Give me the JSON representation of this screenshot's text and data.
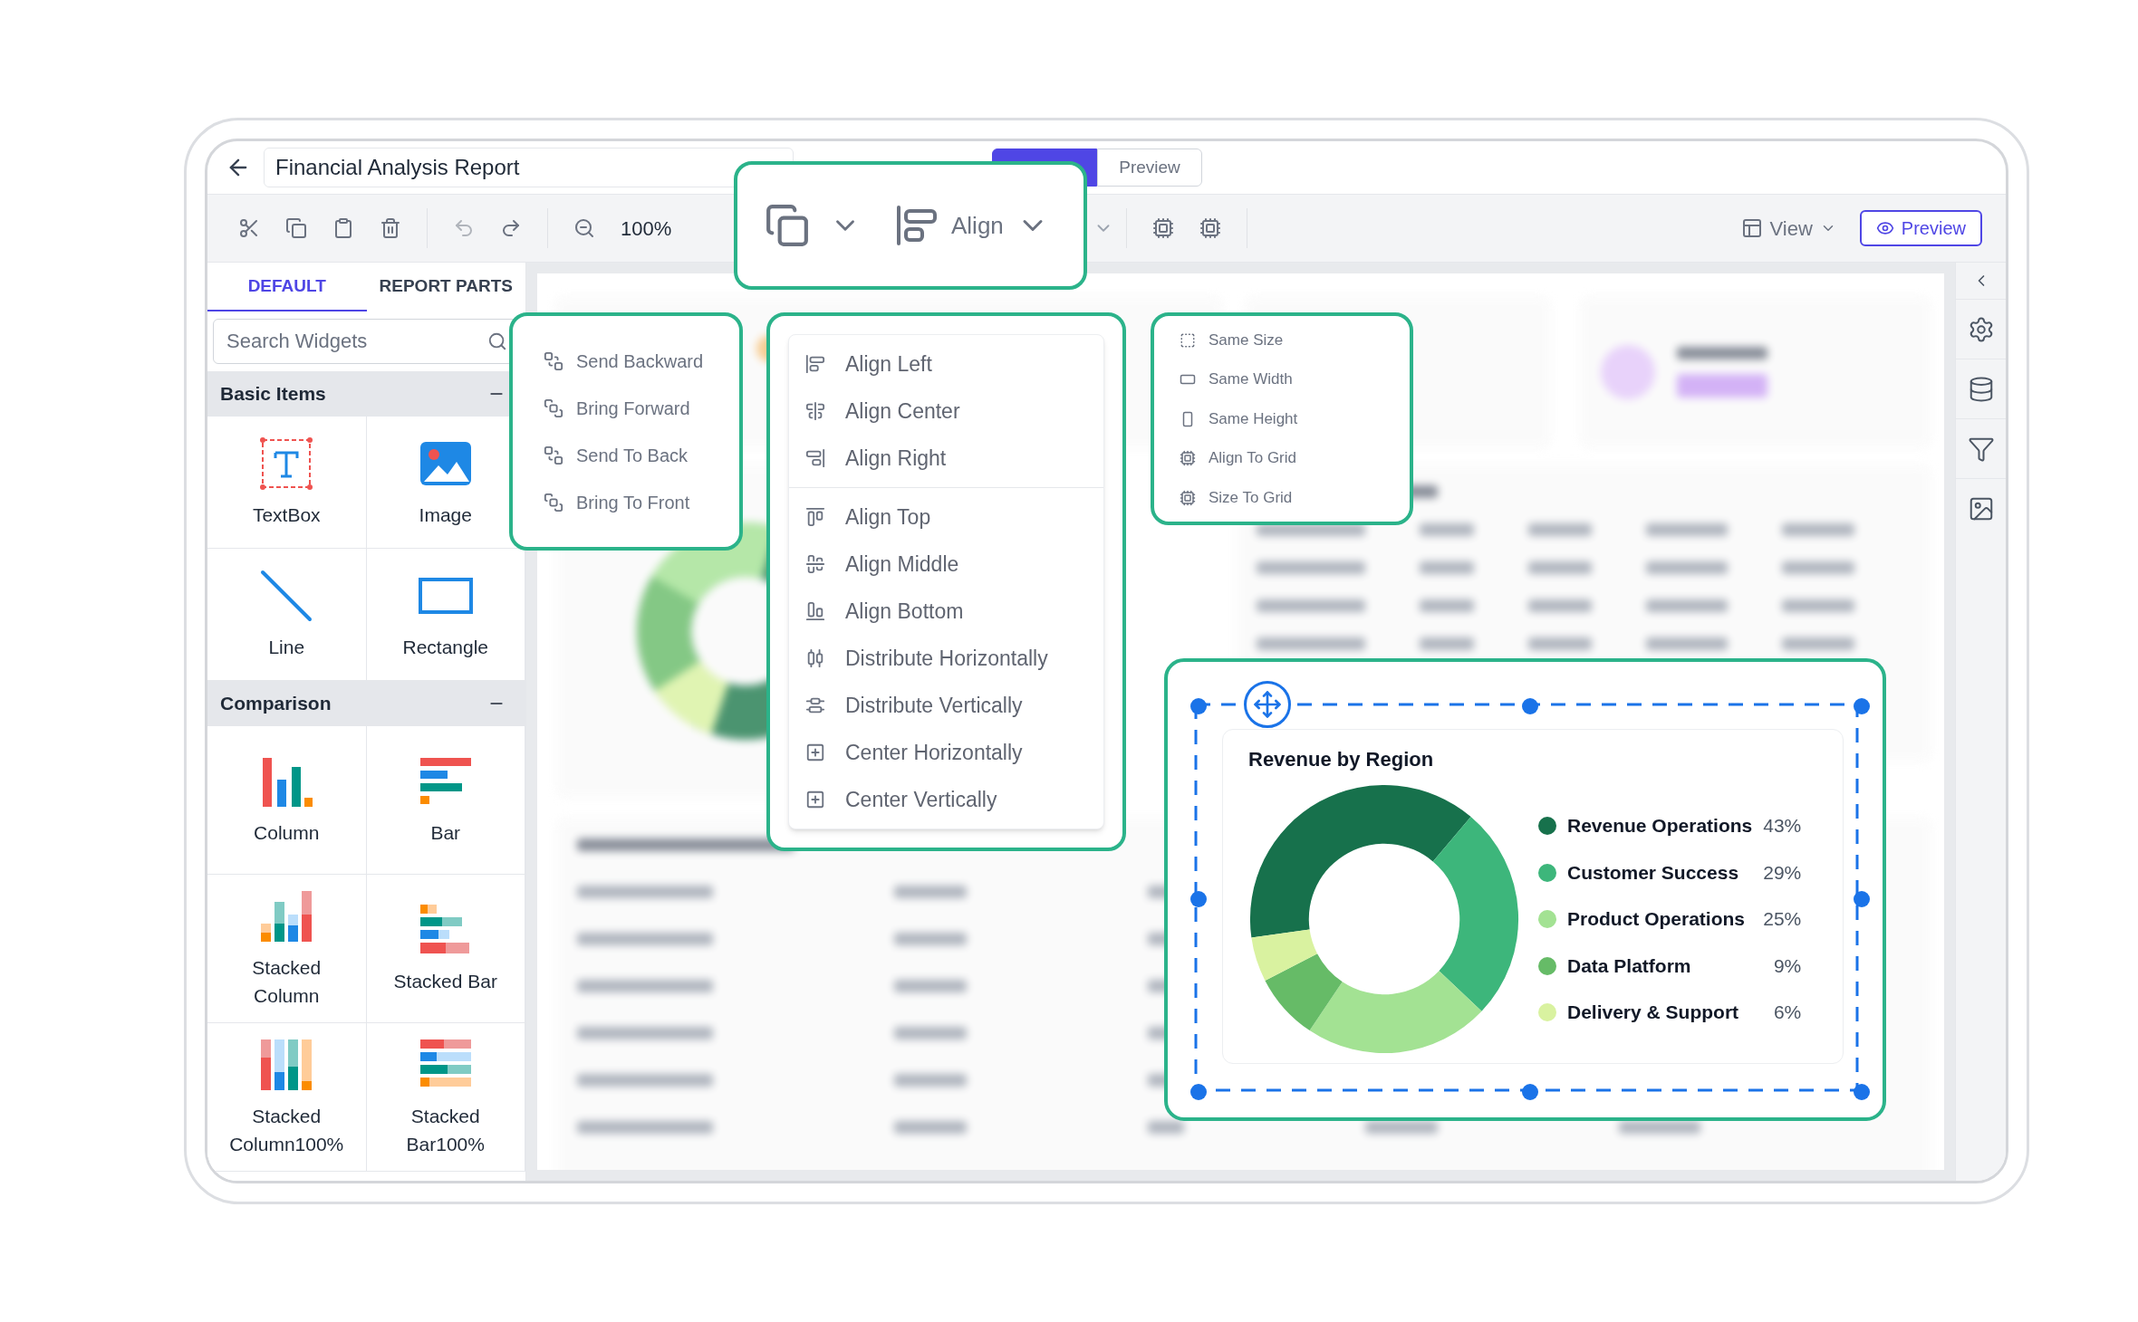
{
  "window": {
    "title": "Financial Analysis Report"
  },
  "mode_tabs": [
    {
      "kind": "design",
      "selected": true
    },
    {
      "kind": "preview",
      "label": "Preview",
      "selected": false
    }
  ],
  "toolbar": {
    "zoom": "100%",
    "view": "View",
    "preview": "Preview"
  },
  "sidebar": {
    "tabs": [
      {
        "label": "DEFAULT",
        "selected": true
      },
      {
        "label": "REPORT PARTS",
        "selected": false
      }
    ],
    "search": {
      "placeholder": "Search Widgets"
    },
    "sections": [
      {
        "title": "Basic Items",
        "expanded": true,
        "items": [
          {
            "label": "TextBox",
            "kind": "textbox"
          },
          {
            "label": "Image",
            "kind": "image"
          },
          {
            "label": "Line",
            "kind": "line"
          },
          {
            "label": "Rectangle",
            "kind": "rectangle"
          }
        ]
      },
      {
        "title": "Comparison",
        "expanded": true,
        "items": [
          {
            "label": "Column",
            "kind": "column"
          },
          {
            "label": "Bar",
            "kind": "bar"
          },
          {
            "label": "Stacked Column",
            "kind": "stacked_column"
          },
          {
            "label": "Stacked Bar",
            "kind": "stacked_bar"
          },
          {
            "label": "Stacked Column100%",
            "kind": "stacked_column100"
          },
          {
            "label": "Stacked Bar100%",
            "kind": "stacked_bar100"
          }
        ]
      }
    ]
  },
  "align_button": {
    "label": "Align"
  },
  "arrange_menu": [
    {
      "label": "Send Backward",
      "kind": "send_backward"
    },
    {
      "label": "Bring Forward",
      "kind": "bring_forward"
    },
    {
      "label": "Send To Back",
      "kind": "send_to_back"
    },
    {
      "label": "Bring To Front",
      "kind": "bring_to_front"
    }
  ],
  "align_menu": [
    {
      "items": [
        {
          "label": "Align Left",
          "kind": "left"
        },
        {
          "label": "Align Center",
          "kind": "center"
        },
        {
          "label": "Align Right",
          "kind": "right"
        }
      ]
    },
    {
      "items": [
        {
          "label": "Align Top",
          "kind": "top"
        },
        {
          "label": "Align Middle",
          "kind": "middle"
        },
        {
          "label": "Align Bottom",
          "kind": "bottom"
        },
        {
          "label": "Distribute Horizontally",
          "kind": "dist_h"
        },
        {
          "label": "Distribute Vertically",
          "kind": "dist_v"
        },
        {
          "label": "Center Horizontally",
          "kind": "center_h"
        },
        {
          "label": "Center Vertically",
          "kind": "center_v"
        }
      ]
    }
  ],
  "size_menu": [
    {
      "label": "Same Size",
      "kind": "same_size"
    },
    {
      "label": "Same Width",
      "kind": "same_width"
    },
    {
      "label": "Same Height",
      "kind": "same_height"
    },
    {
      "label": "Align To Grid",
      "kind": "align_grid"
    },
    {
      "label": "Size To Grid",
      "kind": "size_grid"
    }
  ],
  "chart": {
    "chart_data": {
      "type": "donut",
      "title": "Revenue by Region",
      "legend": "right",
      "categories": [
        "Revenue Operations",
        "Customer Success",
        "Product Operations",
        "Data Platform",
        "Delivery & Support"
      ],
      "values": [
        43,
        29,
        25,
        9,
        6
      ],
      "value_labels": [
        "43%",
        "29%",
        "25%",
        "9%",
        "6%"
      ]
    },
    "slices": [
      {
        "color": "#17714c"
      },
      {
        "color": "#3db67b"
      },
      {
        "color": "#a3e293"
      },
      {
        "color": "#66bb67"
      },
      {
        "color": "#d9f2a0"
      }
    ]
  }
}
